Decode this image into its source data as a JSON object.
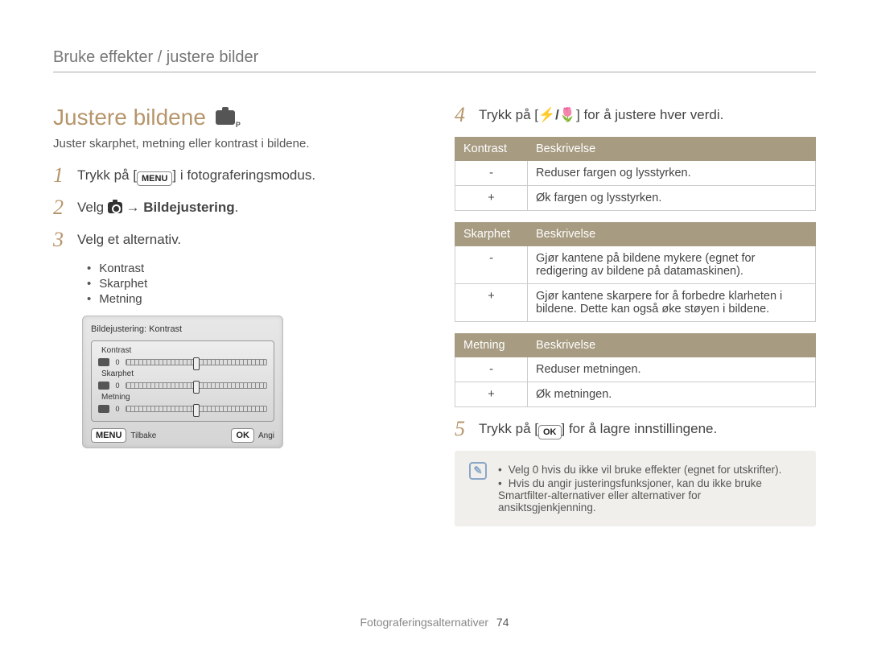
{
  "breadcrumb": "Bruke effekter / justere bilder",
  "title": "Justere bildene",
  "subtitle": "Juster skarphet, metning eller kontrast i bildene.",
  "steps": {
    "s1_a": "Trykk på [",
    "s1_menu": "MENU",
    "s1_b": "] i fotograferingsmodus.",
    "s2_a": "Velg ",
    "s2_arrow": " → ",
    "s2_b": "Bildejustering",
    "s2_c": ".",
    "s3": "Velg et alternativ.",
    "s4_a": "Trykk på [",
    "s4_icons": "⚡/🌷",
    "s4_b": "] for å justere hver verdi.",
    "s5_a": "Trykk på [",
    "s5_ok": "OK",
    "s5_b": "] for å lagre innstillingene."
  },
  "bullets": [
    "Kontrast",
    "Skarphet",
    "Metning"
  ],
  "screenshot": {
    "title": "Bildejustering: Kontrast",
    "rows": [
      "Kontrast",
      "Skarphet",
      "Metning"
    ],
    "zero": "0",
    "back_btn": "MENU",
    "back": "Tilbake",
    "ok_btn": "OK",
    "set": "Angi"
  },
  "tables": {
    "kontrast": {
      "h1": "Kontrast",
      "h2": "Beskrivelse",
      "r1a": "-",
      "r1b": "Reduser fargen og lysstyrken.",
      "r2a": "+",
      "r2b": "Øk fargen og lysstyrken."
    },
    "skarphet": {
      "h1": "Skarphet",
      "h2": "Beskrivelse",
      "r1a": "-",
      "r1b": "Gjør kantene på bildene mykere (egnet for redigering av bildene på datamaskinen).",
      "r2a": "+",
      "r2b": "Gjør kantene skarpere for å forbedre klarheten i bildene. Dette kan også øke støyen i bildene."
    },
    "metning": {
      "h1": "Metning",
      "h2": "Beskrivelse",
      "r1a": "-",
      "r1b": "Reduser metningen.",
      "r2a": "+",
      "r2b": "Øk metningen."
    }
  },
  "note": {
    "l1": "Velg 0 hvis du ikke vil bruke effekter (egnet for utskrifter).",
    "l2": "Hvis du angir justeringsfunksjoner, kan du ikke bruke Smartfilter-alternativer eller alternativer for ansiktsgjenkjenning."
  },
  "footer": {
    "section": "Fotograferingsalternativer",
    "page": "74"
  }
}
